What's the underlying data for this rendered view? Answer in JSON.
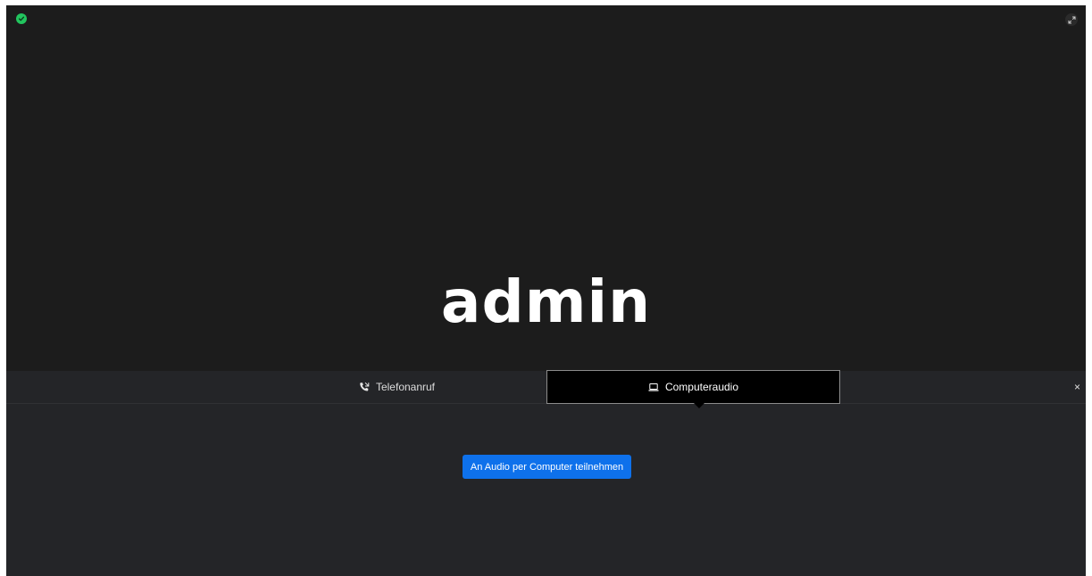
{
  "video": {
    "participant_name": "admin",
    "encryption_icon": "shield-check-icon",
    "expand_icon": "expand-arrows-icon"
  },
  "audio_panel": {
    "tabs": [
      {
        "label": "Telefonanruf",
        "icon": "phone-icon",
        "selected": false
      },
      {
        "label": "Computeraudio",
        "icon": "laptop-icon",
        "selected": true
      }
    ],
    "close_label": "×",
    "join_button_label": "An Audio per Computer teilnehmen"
  },
  "colors": {
    "video_bg": "#1c1c1c",
    "panel_bg": "#242528",
    "accent": "#0e71eb",
    "security_green": "#22c55e"
  }
}
